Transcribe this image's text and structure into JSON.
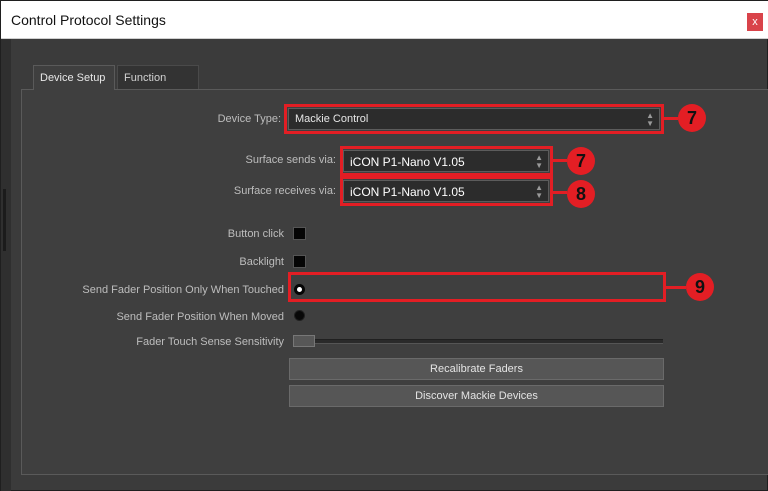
{
  "window": {
    "title": "Control Protocol Settings",
    "close_glyph": "x"
  },
  "tabs": [
    {
      "label": "Device Setup",
      "active": true
    },
    {
      "label": "Function Keys",
      "active": false
    }
  ],
  "fields": {
    "device_type": {
      "label": "Device Type:",
      "value": "Mackie Control"
    },
    "surface_sends": {
      "label": "Surface sends via:",
      "value": "iCON P1-Nano V1.05"
    },
    "surface_receives": {
      "label": "Surface receives via:",
      "value": "iCON P1-Nano V1.05"
    },
    "button_click": {
      "label": "Button click",
      "checked": false
    },
    "backlight": {
      "label": "Backlight",
      "checked": false
    },
    "send_fader_touched": {
      "label": "Send Fader Position Only When Touched",
      "selected": true
    },
    "send_fader_moved": {
      "label": "Send Fader Position When Moved",
      "selected": false
    },
    "fader_touch_sensitivity": {
      "label": "Fader Touch Sense Sensitivity",
      "value": 0
    }
  },
  "buttons": {
    "recalibrate": "Recalibrate Faders",
    "discover": "Discover Mackie Devices"
  },
  "callouts": {
    "device_type": "7",
    "surface_sends": "7",
    "surface_receives": "8",
    "send_fader_touched": "9"
  },
  "colors": {
    "accent_red": "#e31e24",
    "panel": "#3f3f3f",
    "window_bg": "#3b3b3b"
  }
}
